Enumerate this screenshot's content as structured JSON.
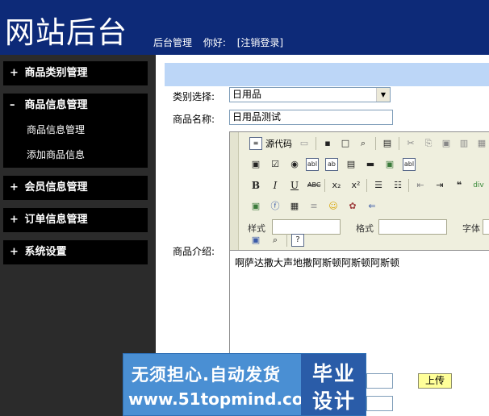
{
  "header": {
    "title": "网站后台",
    "nav": [
      "后台管理",
      "你好:",
      "[注销登录]"
    ]
  },
  "sidebar": {
    "groups": [
      {
        "sign": "+",
        "label": "商品类别管理"
      },
      {
        "sign": "–",
        "label": "商品信息管理",
        "items": [
          "商品信息管理",
          "添加商品信息"
        ]
      },
      {
        "sign": "+",
        "label": "会员信息管理"
      },
      {
        "sign": "+",
        "label": "订单信息管理"
      },
      {
        "sign": "+",
        "label": "系统设置"
      }
    ]
  },
  "form": {
    "category_label": "类别选择:",
    "category_value": "日用品",
    "name_label": "商品名称:",
    "name_value": "日用品测试",
    "intro_label": "商品介绍:",
    "upload_label": "上传"
  },
  "editor": {
    "source_label": "源代码",
    "style_label": "样式",
    "format_label": "格式",
    "font_label": "字体",
    "content": "啊萨达撒大声地撒阿斯顿阿斯顿阿斯顿"
  },
  "watermark": {
    "line1": "无须担心.自动发货",
    "line2": "www.51topmind.com",
    "box_line1": "毕业",
    "box_line2": "设计"
  },
  "colors": {
    "header_bg": "#0d2a78",
    "sidebar_bg": "#2b2b2b",
    "info_bar": "#bcd6f7"
  }
}
